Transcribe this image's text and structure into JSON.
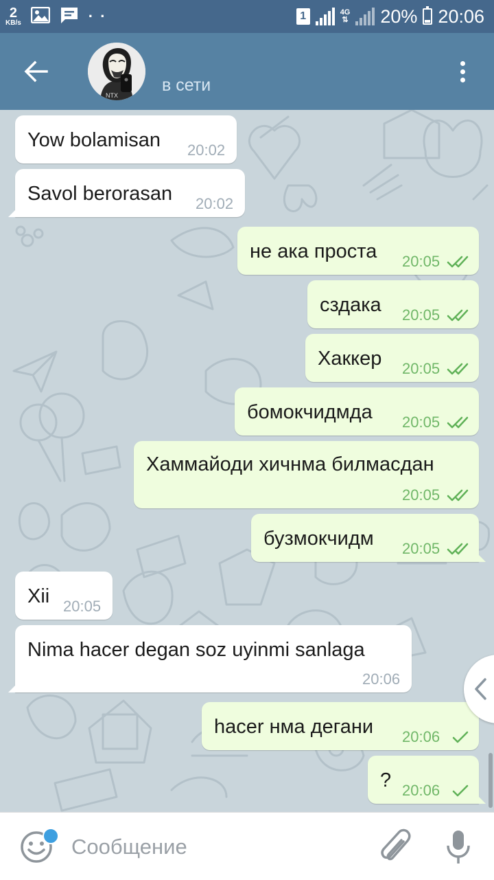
{
  "status_bar": {
    "net_speed_value": "2",
    "net_speed_unit": "KB/s",
    "notification_dots": "· ·",
    "sim_slot": "1",
    "network_type": "4G",
    "battery_percent": "20%",
    "clock": "20:06",
    "icons": [
      "gallery-icon",
      "chat-notification-icon",
      "signal-icon",
      "battery-icon"
    ]
  },
  "header": {
    "status": "в сети",
    "colors": {
      "bar": "#5682a3",
      "status_bar": "#45688c"
    }
  },
  "messages": [
    {
      "direction": "in",
      "text": "Yow bolamisan",
      "time": "20:02"
    },
    {
      "direction": "in",
      "text": "Savol berorasan",
      "time": "20:02"
    },
    {
      "direction": "out",
      "text": "не ака проста",
      "time": "20:05",
      "read": true
    },
    {
      "direction": "out",
      "text": "сздака",
      "time": "20:05",
      "read": true
    },
    {
      "direction": "out",
      "text": "Хаккер",
      "time": "20:05",
      "read": true
    },
    {
      "direction": "out",
      "text": "бомокчидмда",
      "time": "20:05",
      "read": true
    },
    {
      "direction": "out",
      "text": "Хаммайоди хичнма билмасдан",
      "time": "20:05",
      "read": true
    },
    {
      "direction": "out",
      "text": "бузмокчидм",
      "time": "20:05",
      "read": true
    },
    {
      "direction": "in",
      "text": "Xii",
      "time": "20:05"
    },
    {
      "direction": "in",
      "text": "Nima hacer degan soz uyinmi sanlaga",
      "time": "20:06"
    },
    {
      "direction": "out",
      "text": "hacer нма дегани",
      "time": "20:06",
      "read": false
    },
    {
      "direction": "out",
      "text": "?",
      "time": "20:06",
      "read": false
    }
  ],
  "composer": {
    "placeholder": "Сообщение"
  },
  "colors": {
    "incoming_bubble": "#ffffff",
    "outgoing_bubble": "#effdde",
    "check_marks": "#5fb157",
    "chat_background": "#c9d5db"
  }
}
